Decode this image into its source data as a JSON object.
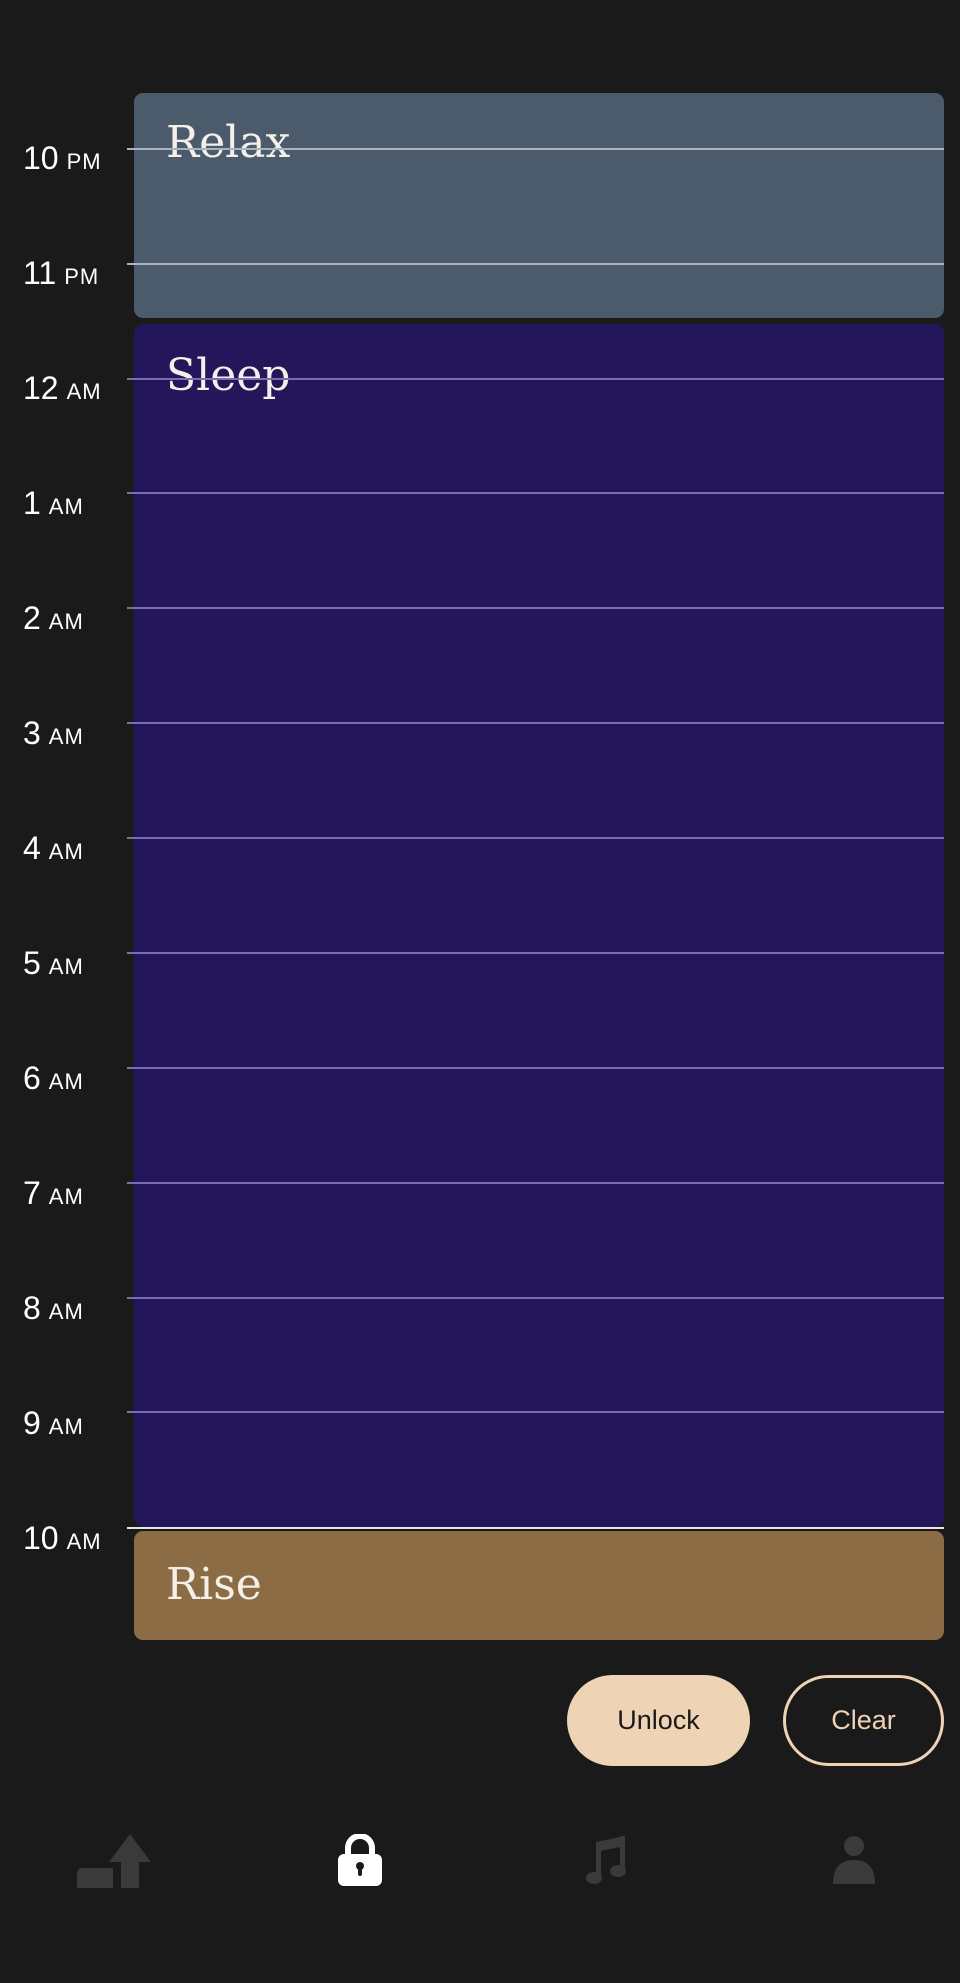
{
  "schedule": {
    "blocks": [
      {
        "label": "Relax",
        "color": "#4b5b6c"
      },
      {
        "label": "Sleep",
        "color": "#23165a"
      },
      {
        "label": "Rise",
        "color": "#8b6c45"
      }
    ],
    "hours": [
      {
        "num": "10",
        "mer": "PM"
      },
      {
        "num": "11",
        "mer": "PM"
      },
      {
        "num": "12",
        "mer": "AM"
      },
      {
        "num": "1",
        "mer": "AM"
      },
      {
        "num": "2",
        "mer": "AM"
      },
      {
        "num": "3",
        "mer": "AM"
      },
      {
        "num": "4",
        "mer": "AM"
      },
      {
        "num": "5",
        "mer": "AM"
      },
      {
        "num": "6",
        "mer": "AM"
      },
      {
        "num": "7",
        "mer": "AM"
      },
      {
        "num": "8",
        "mer": "AM"
      },
      {
        "num": "9",
        "mer": "AM"
      },
      {
        "num": "10",
        "mer": "AM"
      }
    ]
  },
  "actions": {
    "unlock_label": "Unlock",
    "clear_label": "Clear"
  },
  "nav": {
    "items": [
      {
        "icon": "sunrise-icon",
        "active": false
      },
      {
        "icon": "lock-icon",
        "active": true
      },
      {
        "icon": "music-note-icon",
        "active": false
      },
      {
        "icon": "person-icon",
        "active": false
      }
    ]
  },
  "colors": {
    "background": "#1a1a1a",
    "accent": "#efd3b5",
    "nav_inactive": "#3a3a3a",
    "nav_active": "#ffffff"
  }
}
